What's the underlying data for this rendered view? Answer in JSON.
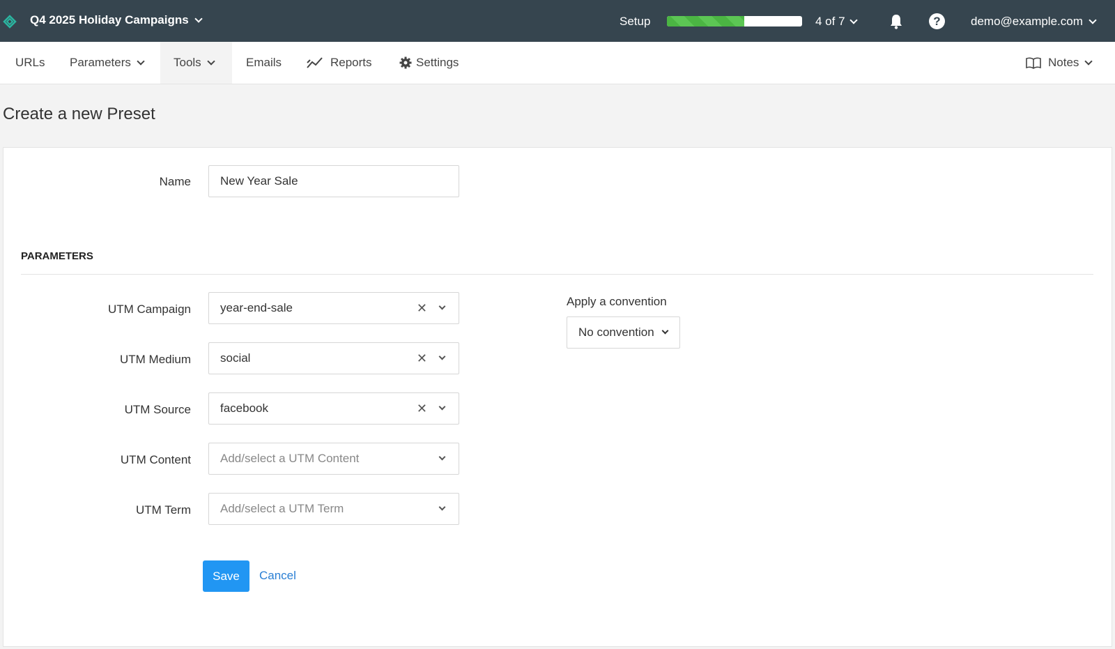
{
  "topbar": {
    "workspace": "Q4 2025 Holiday Campaigns",
    "setup_label": "Setup",
    "setup_progress": 0.57,
    "steps": "4 of 7",
    "account": "demo@example.com",
    "help_glyph": "?"
  },
  "nav": {
    "urls": "URLs",
    "parameters": "Parameters",
    "tools": "Tools",
    "emails": "Emails",
    "reports": "Reports",
    "settings": "Settings",
    "notes": "Notes"
  },
  "page": {
    "title": "Create a new Preset"
  },
  "form": {
    "name_label": "Name",
    "name_value": "New Year Sale",
    "section_title": "PARAMETERS",
    "utm_campaign_label": "UTM Campaign",
    "utm_campaign_value": "year-end-sale",
    "utm_medium_label": "UTM Medium",
    "utm_medium_value": "social",
    "utm_source_label": "UTM Source",
    "utm_source_value": "facebook",
    "utm_content_label": "UTM Content",
    "utm_content_placeholder": "Add/select a UTM Content",
    "utm_term_label": "UTM Term",
    "utm_term_placeholder": "Add/select a UTM Term",
    "convention_label": "Apply a convention",
    "convention_value": "No convention",
    "clear_glyph": "✕",
    "save_label": "Save",
    "cancel_label": "Cancel"
  },
  "icons": {
    "logo": "logo-icon",
    "bell": "bell-icon",
    "help": "help-icon",
    "reports": "chart-line-icon",
    "settings": "gear-icon",
    "notes": "book-icon"
  },
  "colors": {
    "topbar": "#36454f",
    "progress": "#4bb543",
    "primary": "#2196f3",
    "link": "#2a7fd4"
  }
}
